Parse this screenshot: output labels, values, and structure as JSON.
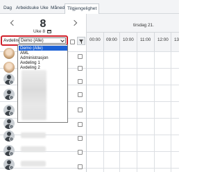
{
  "tabs": [
    {
      "label": "Dag",
      "active": false
    },
    {
      "label": "Arbeidsuke",
      "active": false
    },
    {
      "label": "Uke",
      "active": false
    },
    {
      "label": "Måned",
      "active": false
    },
    {
      "label": "Tilgjengelighet",
      "active": true
    }
  ],
  "header": {
    "day_number": "8",
    "week_label": "Uke 8",
    "date_label": "tirsdag 21."
  },
  "department": {
    "label": "Avdeling",
    "selected_value": "Demo (Alle)",
    "options": [
      "Demo (Alle)",
      "AML",
      "Administrasjon",
      "Avdeling 1",
      "Avdeling 2"
    ]
  },
  "hours": [
    "00:00",
    "09:00",
    "10:00",
    "11:00",
    "12:00",
    "13"
  ],
  "colors": {
    "highlight_border": "#d0202a",
    "selected_option_bg": "#1e63d6",
    "header_bg": "#f3f4f6"
  },
  "icons": [
    "chevron-left-icon",
    "chevron-right-icon",
    "calendar-icon",
    "filter-icon",
    "user-avatar-icon"
  ]
}
